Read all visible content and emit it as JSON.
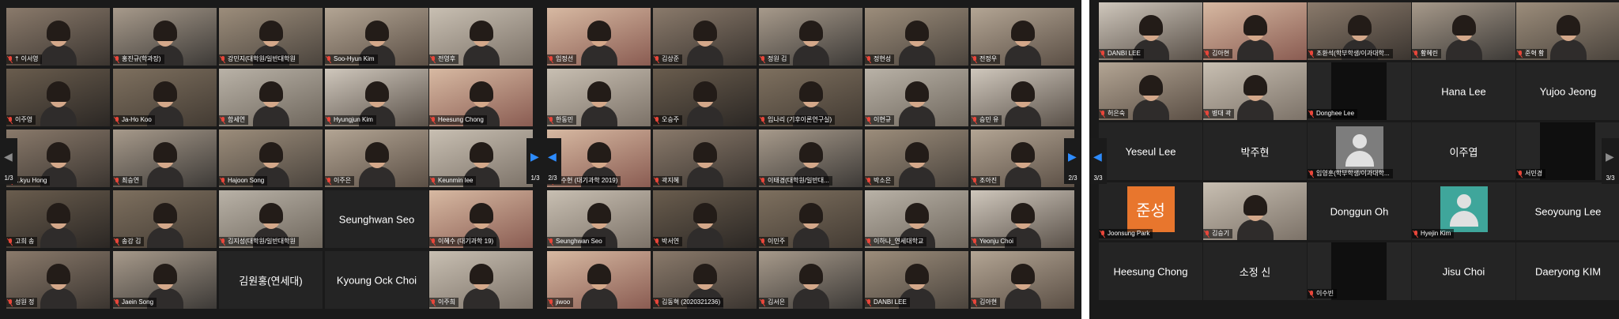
{
  "panels": [
    {
      "page_indicator": "1/3",
      "tiles": [
        {
          "name": "이서영",
          "pinned": true,
          "mode": "video",
          "active": true
        },
        {
          "name": "홍진규(학과장)",
          "mode": "video"
        },
        {
          "name": "강민지(대학원/일반대학원",
          "mode": "video"
        },
        {
          "name": "Soo-Hyun Kim",
          "mode": "video"
        },
        {
          "name": "전영후",
          "mode": "video"
        },
        {
          "name": "이주영",
          "mode": "video"
        },
        {
          "name": "Ja-Ho Koo",
          "mode": "video"
        },
        {
          "name": "함세연",
          "mode": "video"
        },
        {
          "name": "Hyungjun Kim",
          "mode": "video"
        },
        {
          "name": "Heesung Chong",
          "mode": "video"
        },
        {
          "name": "...kyu Hong",
          "mode": "video"
        },
        {
          "name": "최승연",
          "mode": "video"
        },
        {
          "name": "Hajoon Song",
          "mode": "video"
        },
        {
          "name": "이주은",
          "mode": "video"
        },
        {
          "name": "Keunmin lee",
          "mode": "video"
        },
        {
          "name": "고희 송",
          "mode": "video"
        },
        {
          "name": "송강 김",
          "mode": "video"
        },
        {
          "name": "김지성(대학원/일반대학원",
          "mode": "video"
        },
        {
          "display": "Seunghwan Seo",
          "mode": "text"
        },
        {
          "name": "이혜수 (대기과학 19)",
          "mode": "video"
        },
        {
          "name": "성원 정",
          "mode": "video"
        },
        {
          "name": "Jaein Song",
          "mode": "video"
        },
        {
          "display": "김원홍(연세대)",
          "mode": "text"
        },
        {
          "display": "Kyoung Ock Choi",
          "mode": "text"
        },
        {
          "name": "이주희",
          "mode": "video"
        }
      ]
    },
    {
      "page_indicator": "2/3",
      "tiles": [
        {
          "name": "임정선",
          "mode": "video"
        },
        {
          "name": "김상준",
          "mode": "video"
        },
        {
          "name": "정원 김",
          "mode": "video"
        },
        {
          "name": "정현성",
          "mode": "video"
        },
        {
          "name": "전정우",
          "mode": "video"
        },
        {
          "name": "한동민",
          "mode": "video"
        },
        {
          "name": "오승주",
          "mode": "video"
        },
        {
          "name": "임나리 (기후이론연구실)",
          "mode": "video"
        },
        {
          "name": "이현규",
          "mode": "video"
        },
        {
          "name": "승민 유",
          "mode": "video"
        },
        {
          "name": "...수현 (대기과학 2019)",
          "mode": "video"
        },
        {
          "name": "곽지혜",
          "mode": "video"
        },
        {
          "name": "이태경(대학원/일반대...",
          "mode": "video"
        },
        {
          "name": "박소은",
          "mode": "video"
        },
        {
          "name": "조아진",
          "mode": "video"
        },
        {
          "name": "Seunghwan Seo",
          "mode": "video"
        },
        {
          "name": "박서연",
          "mode": "video"
        },
        {
          "name": "이민주",
          "mode": "video"
        },
        {
          "name": "이하나_연세대학교",
          "mode": "video"
        },
        {
          "name": "Yeonju Choi",
          "mode": "video"
        },
        {
          "name": "jiwoo",
          "mode": "video"
        },
        {
          "name": "김동혁 (2020321236)",
          "mode": "video"
        },
        {
          "name": "김서은",
          "mode": "video"
        },
        {
          "name": "DANBI LEE",
          "mode": "video"
        },
        {
          "name": "김아현",
          "mode": "video"
        }
      ]
    },
    {
      "page_indicator": "3/3",
      "tiles": [
        {
          "name": "DANBI LEE",
          "mode": "video"
        },
        {
          "name": "김아현",
          "mode": "video"
        },
        {
          "name": "조환석(학부학생/이과대학...",
          "mode": "video"
        },
        {
          "name": "황혜린",
          "mode": "video"
        },
        {
          "name": "준혁 황",
          "mode": "video"
        },
        {
          "name": "허은숙",
          "mode": "video"
        },
        {
          "name": "병대 곽",
          "mode": "video"
        },
        {
          "name": "Donghee Lee",
          "mode": "dark"
        },
        {
          "display": "Hana Lee",
          "mode": "text"
        },
        {
          "display": "Yujoo Jeong",
          "mode": "text"
        },
        {
          "display": "Yeseul Lee",
          "mode": "text"
        },
        {
          "display": "박주현",
          "mode": "text"
        },
        {
          "name": "임영훈(학부학생/이과대학...",
          "mode": "avatar"
        },
        {
          "display": "이주엽",
          "mode": "text"
        },
        {
          "name": "서민경",
          "mode": "dark"
        },
        {
          "name": "Joonsung Park",
          "mode": "badge",
          "badge": "준성",
          "badge_color": "#e8762d"
        },
        {
          "name": "김승기",
          "mode": "video"
        },
        {
          "display": "Donggun Oh",
          "mode": "text"
        },
        {
          "name": "Hyejin Kim",
          "mode": "badge",
          "badge_color": "#3fa69b"
        },
        {
          "display": "Seoyoung Lee",
          "mode": "text"
        },
        {
          "display": "Heesung Chong",
          "mode": "text"
        },
        {
          "display": "소정 신",
          "mode": "text"
        },
        {
          "name": "이수빈",
          "mode": "dark"
        },
        {
          "display": "Jisu Choi",
          "mode": "text"
        },
        {
          "display": "Daeryong KIM",
          "mode": "text"
        }
      ]
    }
  ],
  "colors": {
    "panel_bg": "#1a1a1a",
    "tile_bg": "#242424",
    "active_speaker": "#d9e57b",
    "nav_arrow": "#2d8cff",
    "mute": "#e8463a"
  }
}
